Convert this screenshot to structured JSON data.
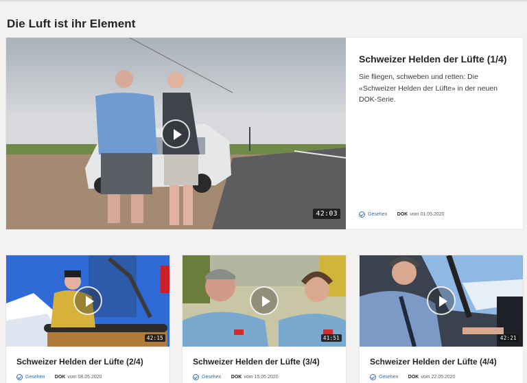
{
  "section": {
    "title": "Die Luft ist ihr Element"
  },
  "hero": {
    "title": "Schweizer Helden der Lüfte (1/4)",
    "description": "Sie fliegen, schweben und retten: Die «Schweizer Helden der Lüfte» in der neuen DOK-Serie.",
    "duration": "42:03",
    "seen_label": "Gesehen",
    "show": "DOK",
    "date_text": "vom 01.05.2020"
  },
  "cards": [
    {
      "title": "Schweizer Helden der Lüfte (2/4)",
      "duration": "42:15",
      "seen_label": "Gesehen",
      "show": "DOK",
      "date_text": "vom 08.05.2020"
    },
    {
      "title": "Schweizer Helden der Lüfte (3/4)",
      "duration": "41:51",
      "seen_label": "Gesehen",
      "show": "DOK",
      "date_text": "vom 15.05.2020"
    },
    {
      "title": "Schweizer Helden der Lüfte (4/4)",
      "duration": "42:21",
      "seen_label": "Gesehen",
      "show": "DOK",
      "date_text": "vom 22.05.2020"
    }
  ],
  "icons": {
    "play": "play-icon",
    "seen": "check-circle-icon"
  },
  "colors": {
    "accent": "#2f6bb4",
    "background": "#f3f2f1",
    "card": "#ffffff"
  }
}
